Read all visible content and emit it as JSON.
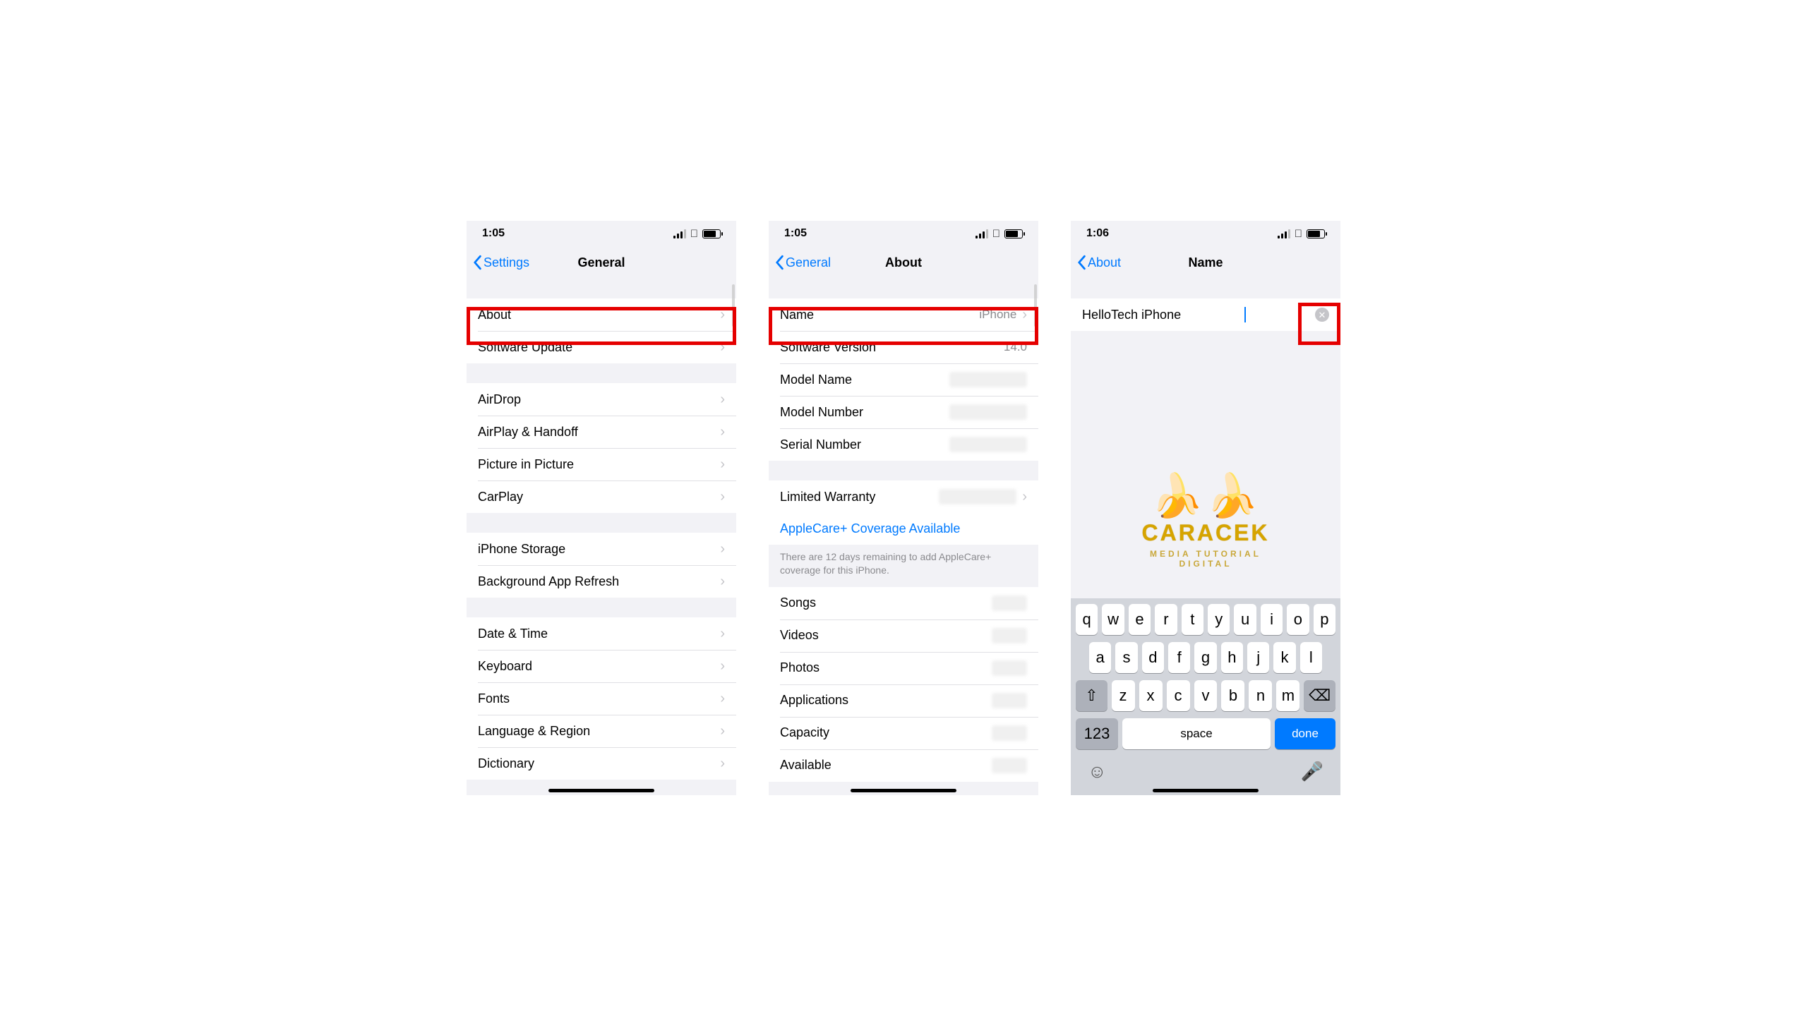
{
  "phone1": {
    "time": "1:05",
    "back": "Settings",
    "title": "General",
    "groups": [
      [
        "About",
        "Software Update"
      ],
      [
        "AirDrop",
        "AirPlay & Handoff",
        "Picture in Picture",
        "CarPlay"
      ],
      [
        "iPhone Storage",
        "Background App Refresh"
      ],
      [
        "Date & Time",
        "Keyboard",
        "Fonts",
        "Language & Region",
        "Dictionary"
      ]
    ]
  },
  "phone2": {
    "time": "1:05",
    "back": "General",
    "title": "About",
    "name_label": "Name",
    "name_value": "iPhone",
    "rows": [
      {
        "l": "Software Version",
        "v": "14.0"
      },
      {
        "l": "Model Name",
        "blur": true
      },
      {
        "l": "Model Number",
        "blur": true
      },
      {
        "l": "Serial Number",
        "blur": true
      }
    ],
    "warranty": "Limited Warranty",
    "applecare": "AppleCare+ Coverage Available",
    "footnote": "There are 12 days remaining to add AppleCare+ coverage for this iPhone.",
    "rows2": [
      "Songs",
      "Videos",
      "Photos",
      "Applications",
      "Capacity",
      "Available"
    ]
  },
  "phone3": {
    "time": "1:06",
    "back": "About",
    "title": "Name",
    "value": "HelloTech iPhone",
    "watermark_brand": "CARACEK",
    "watermark_tag": "MEDIA TUTORIAL DIGITAL",
    "keyboard": {
      "r1": [
        "q",
        "w",
        "e",
        "r",
        "t",
        "y",
        "u",
        "i",
        "o",
        "p"
      ],
      "r2": [
        "a",
        "s",
        "d",
        "f",
        "g",
        "h",
        "j",
        "k",
        "l"
      ],
      "r3": [
        "z",
        "x",
        "c",
        "v",
        "b",
        "n",
        "m"
      ],
      "k123": "123",
      "space": "space",
      "done": "done"
    }
  }
}
